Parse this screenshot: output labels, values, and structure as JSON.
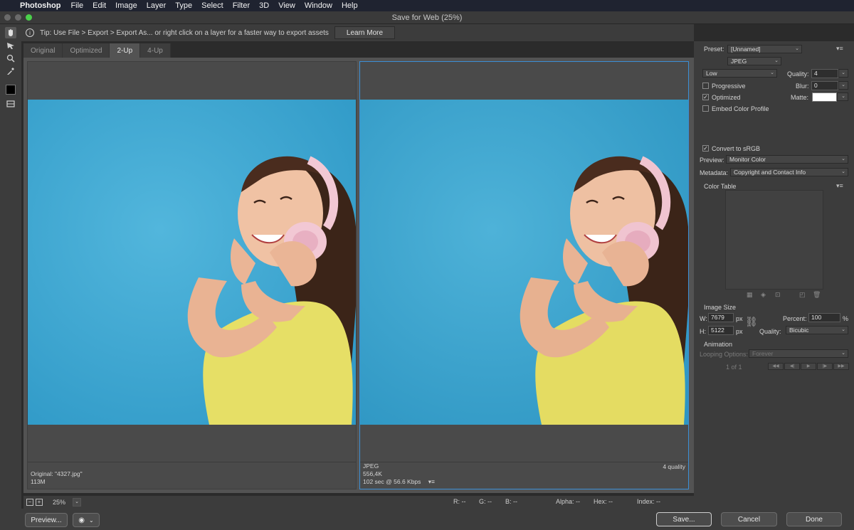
{
  "menubar": {
    "app": "Photoshop",
    "items": [
      "File",
      "Edit",
      "Image",
      "Layer",
      "Type",
      "Select",
      "Filter",
      "3D",
      "View",
      "Window",
      "Help"
    ]
  },
  "window": {
    "title": "Save for Web (25%)"
  },
  "tip": {
    "text": "Tip: Use File > Export > Export As...  or right click on a layer for a faster way to export assets",
    "button": "Learn More"
  },
  "tabs": [
    "Original",
    "Optimized",
    "2-Up",
    "4-Up"
  ],
  "active_tab": "2-Up",
  "panes": {
    "left": {
      "name": "Original: \"4327.jpg\"",
      "size": "113M"
    },
    "right": {
      "format": "JPEG",
      "size": "556,4K",
      "time": "102 sec @ 56.6 Kbps",
      "quality": "4 quality"
    }
  },
  "status": {
    "zoom": "25%",
    "r": "R: --",
    "g": "G: --",
    "b": "B: --",
    "alpha": "Alpha: --",
    "hex": "Hex: --",
    "index": "Index: --"
  },
  "buttons": {
    "preview": "Preview...",
    "save": "Save...",
    "cancel": "Cancel",
    "done": "Done"
  },
  "settings": {
    "preset_label": "Preset:",
    "preset_value": "[Unnamed]",
    "format": "JPEG",
    "compression": "Low",
    "quality_label": "Quality:",
    "quality_value": "4",
    "progressive_label": "Progressive",
    "progressive": false,
    "blur_label": "Blur:",
    "blur_value": "0",
    "optimized_label": "Optimized",
    "optimized": true,
    "matte_label": "Matte:",
    "embed_label": "Embed Color Profile",
    "embed": false,
    "srgb_label": "Convert to sRGB",
    "srgb": true,
    "preview_label": "Preview:",
    "preview_value": "Monitor Color",
    "metadata_label": "Metadata:",
    "metadata_value": "Copyright and Contact Info",
    "color_table_label": "Color Table",
    "image_size_label": "Image Size",
    "w_label": "W:",
    "w_value": "7679",
    "h_label": "H:",
    "h_value": "5122",
    "px": "px",
    "percent_label": "Percent:",
    "percent_value": "100",
    "percent_sign": "%",
    "resample_label": "Quality:",
    "resample_value": "Bicubic",
    "animation_label": "Animation",
    "looping_label": "Looping Options:",
    "looping_value": "Forever",
    "frame_counter": "1 of 1"
  },
  "colors": {
    "sky": "#3fa9d4",
    "shirt": "#e8e26a",
    "selection": "#3b8fd6",
    "headphone": "#f2c8d4"
  }
}
